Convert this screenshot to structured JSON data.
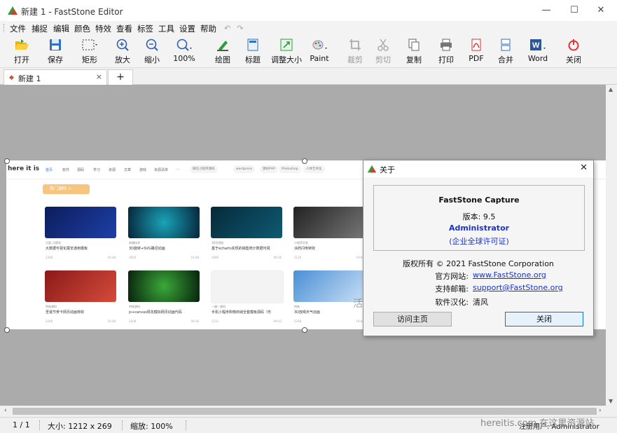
{
  "window": {
    "title": "新建 1 - FastStone Editor",
    "controls": {
      "minimize": "—",
      "maximize": "☐",
      "close": "✕"
    }
  },
  "menu": {
    "items": [
      "文件",
      "捕捉",
      "编辑",
      "颜色",
      "特效",
      "查看",
      "标签",
      "工具",
      "设置",
      "帮助"
    ],
    "undo": "↶",
    "redo": "↷"
  },
  "toolbar": {
    "open": "打开",
    "save": "保存",
    "rect": "矩形",
    "zoom_in": "放大",
    "zoom_out": "缩小",
    "zoom100": "100%",
    "draw": "绘图",
    "caption": "标题",
    "resize": "调整大小",
    "paint": "Paint",
    "crop": "裁剪",
    "cut": "剪切",
    "copy": "复制",
    "print": "打印",
    "pdf": "PDF",
    "merge": "合并",
    "word": "Word",
    "close": "关闭"
  },
  "tabs": {
    "active": "新建 1",
    "close": "×",
    "add": "+"
  },
  "capture": {
    "site_name": "here it is",
    "nav": [
      "首页",
      "软件",
      "源码",
      "学习",
      "资源",
      "文章",
      "游戏",
      "资源清单",
      "···"
    ],
    "pills": [
      "微信小程序源码",
      "wordpress",
      "源码PHP",
      "Photoshop",
      "人体艺术化"
    ],
    "hot_label": "热门源码 >",
    "cards": [
      {
        "tag": "大屏_可视化",
        "title": "大数据可视化展览通用模板",
        "views": "2308",
        "time": "19:48"
      },
      {
        "tag": "前端技术",
        "title": "3D旋转+SVG路径动画",
        "views": "2659",
        "time": "19:48"
      },
      {
        "tag": "3D可视化",
        "title": "基于echarts实现的销售统计数据可视",
        "views": "2680",
        "time": "09:36"
      },
      {
        "tag": "小程序开发",
        "title": "涂药闪电特效",
        "views": "2125",
        "time": "19:48"
      },
      {
        "tag": "特效源码",
        "title": "圣诞节贺卡网页动画特效",
        "views": "2268",
        "time": "19:48"
      },
      {
        "tag": "特效源码",
        "title": "js+canvas现花模拟网页动画代码",
        "views": "2208",
        "time": "09:36"
      },
      {
        "tag": "一键一源码",
        "title": "手机小程序购物商城全套模板源码（伤",
        "views": "2212",
        "time": "09:42"
      },
      {
        "tag": "特效",
        "title": "3D放晴天气动画",
        "views": "2268",
        "time": "19:48"
      }
    ],
    "watermark": "活"
  },
  "about_dialog": {
    "title": "关于",
    "close": "✕",
    "product": "FastStone Capture",
    "version": "版本: 9.5",
    "user": "Administrator",
    "license": "(企业全球许可证)",
    "copyright": "版权所有 © 2021 FastStone Corporation",
    "website_label": "官方网站:",
    "website": "www.FastStone.org",
    "email_label": "支持邮箱:",
    "email": "support@FastStone.org",
    "localization_label": "软件汉化:",
    "localization": "清风",
    "visit_button": "访问主页",
    "close_button": "关闭"
  },
  "status": {
    "page": "1 / 1",
    "size": "大小:  1212 x 269",
    "zoom": "缩放:  100%",
    "registered": "注册用户:  Administrator",
    "watermark": "hereitis.com 在这里资源站"
  },
  "colors": {
    "accent": "#1a33c7",
    "canvas_bg": "#ababab",
    "hot_orange": "#f7c57d"
  }
}
